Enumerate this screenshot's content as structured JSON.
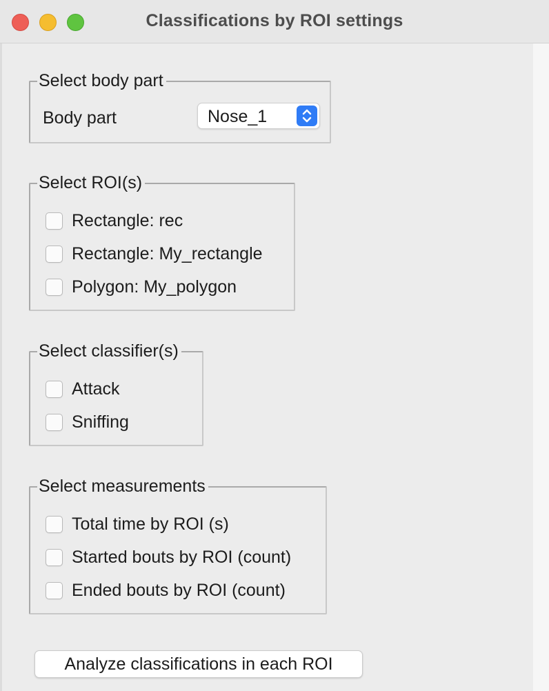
{
  "window": {
    "title": "Classifications by ROI settings"
  },
  "body_part_group": {
    "legend": "Select body part",
    "label": "Body part",
    "selected": "Nose_1"
  },
  "roi_group": {
    "legend": "Select ROI(s)",
    "items": [
      {
        "label": "Rectangle: rec",
        "checked": false
      },
      {
        "label": "Rectangle: My_rectangle",
        "checked": false
      },
      {
        "label": "Polygon: My_polygon",
        "checked": false
      }
    ]
  },
  "classifier_group": {
    "legend": "Select classifier(s)",
    "items": [
      {
        "label": "Attack",
        "checked": false
      },
      {
        "label": "Sniffing",
        "checked": false
      }
    ]
  },
  "measurement_group": {
    "legend": "Select measurements",
    "items": [
      {
        "label": "Total time by ROI (s)",
        "checked": false
      },
      {
        "label": "Started bouts by ROI (count)",
        "checked": false
      },
      {
        "label": "Ended bouts by ROI (count)",
        "checked": false
      }
    ]
  },
  "actions": {
    "analyze_label": "Analyze classifications in each ROI"
  },
  "colors": {
    "close": "#ee5f57",
    "minimize": "#f5bd30",
    "maximize": "#5fc440",
    "select_accent": "#2f7cf6"
  }
}
